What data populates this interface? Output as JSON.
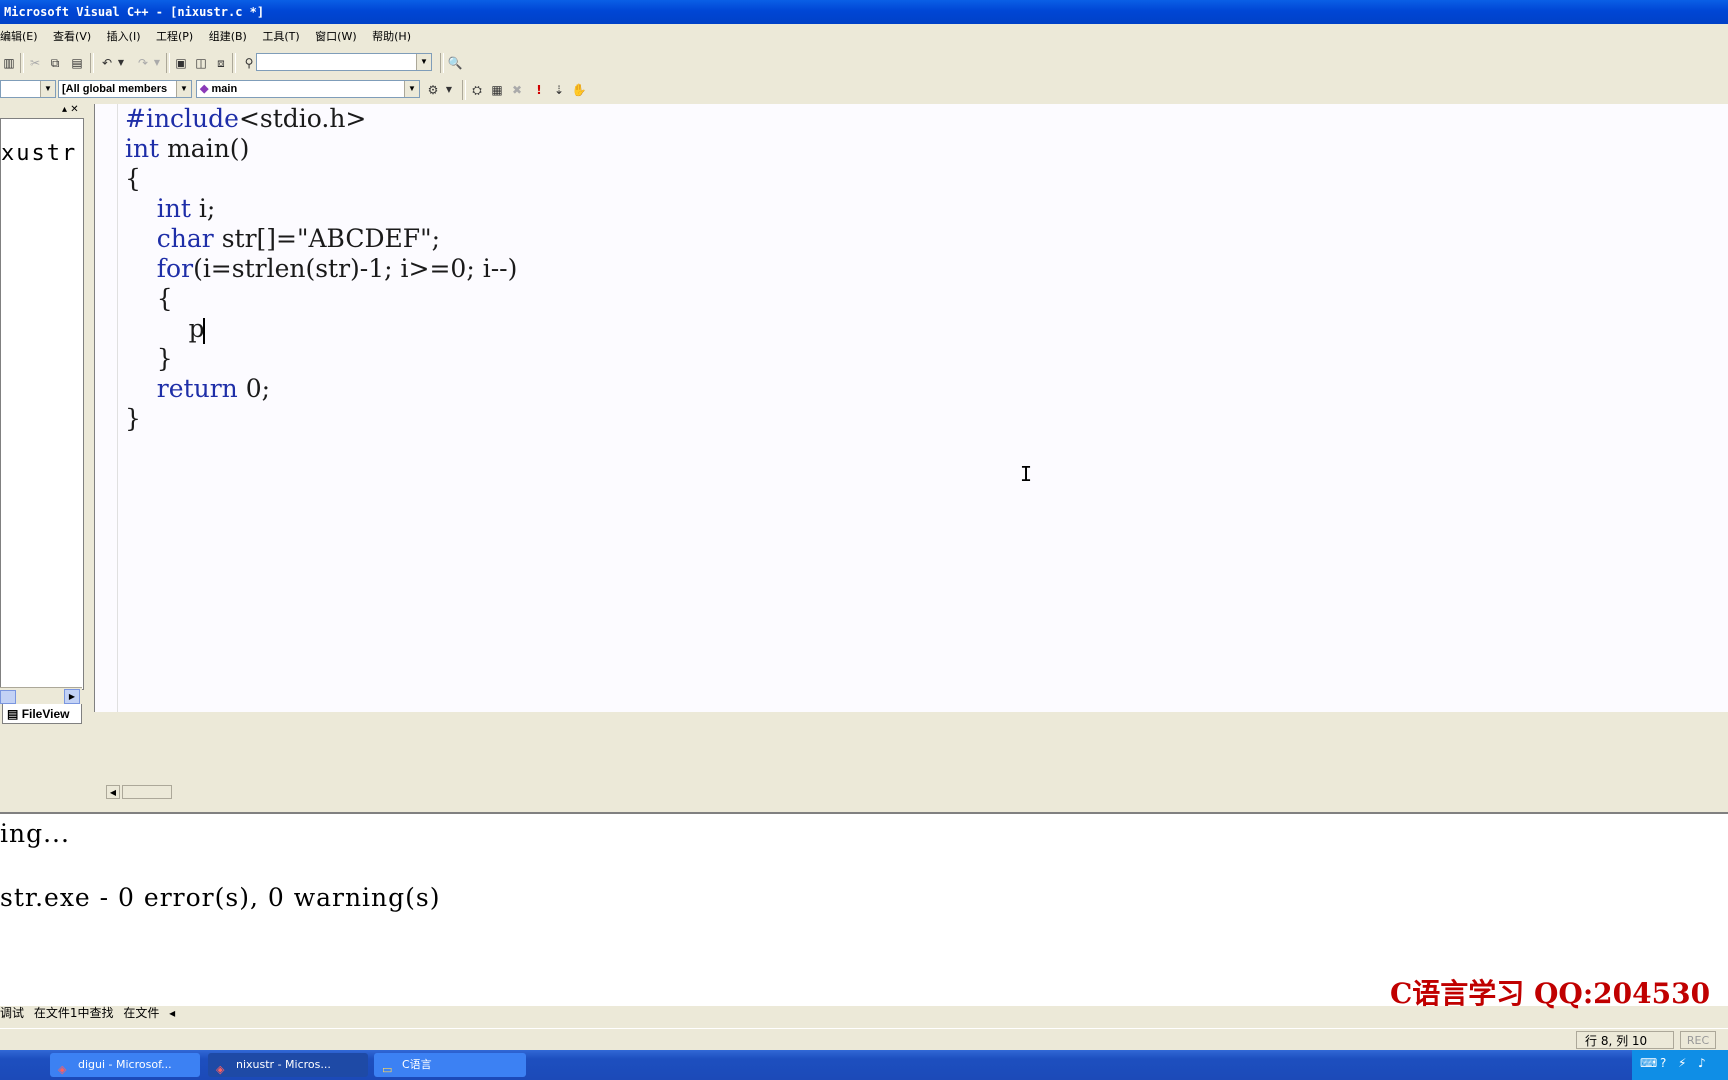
{
  "window": {
    "title": "Microsoft Visual C++ - [nixustr.c *]"
  },
  "menu": [
    "编辑(E)",
    "查看(V)",
    "插入(I)",
    "工程(P)",
    "组建(B)",
    "工具(T)",
    "窗口(W)",
    "帮助(H)"
  ],
  "toolbar2": {
    "class_combo": "[All global members",
    "function_combo": "main"
  },
  "workspace": {
    "tree_item": "xustr",
    "tab": "FileView"
  },
  "editor": {
    "lines": [
      "#include<stdio.h>",
      "int main()",
      "{",
      "    int i;",
      "    char str[]=\"ABCDEF\";",
      "    for(i=strlen(str)-1; i>=0; i--)",
      "    {",
      "        p",
      "    }",
      "    return 0;",
      "}"
    ]
  },
  "output": {
    "lines": [
      "ing...",
      "",
      "str.exe - 0 error(s), 0 warning(s)"
    ],
    "tabs": [
      "调试",
      "在文件1中查找",
      "在文件"
    ]
  },
  "watermark": "C语言学习  QQ:204530",
  "status": {
    "position": "行 8, 列 10",
    "rec": "REC"
  },
  "taskbar": {
    "items": [
      "digui - Microsof...",
      "nixustr - Micros...",
      "C语言"
    ]
  },
  "colors": {
    "titlebar": "#0a5fe6",
    "keyword": "#1e2ea8",
    "watermark": "#c00000",
    "taskbar": "#1d4fbf"
  }
}
